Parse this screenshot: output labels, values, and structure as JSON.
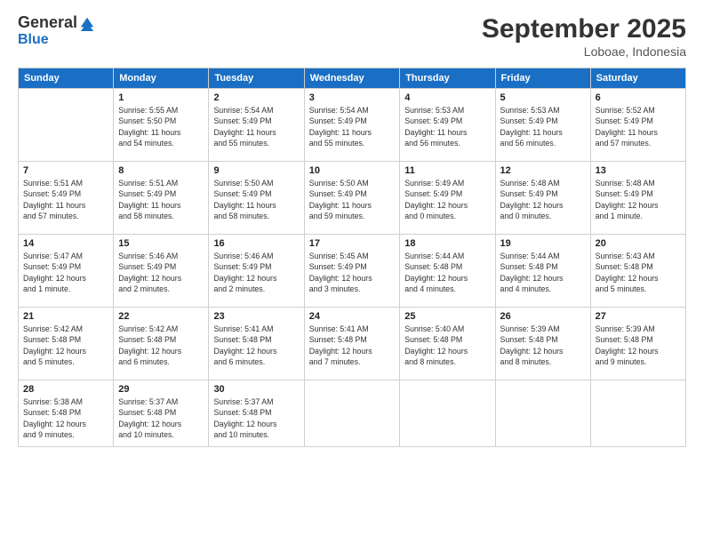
{
  "header": {
    "logo_line1": "General",
    "logo_line2": "Blue",
    "month": "September 2025",
    "location": "Loboae, Indonesia"
  },
  "weekdays": [
    "Sunday",
    "Monday",
    "Tuesday",
    "Wednesday",
    "Thursday",
    "Friday",
    "Saturday"
  ],
  "weeks": [
    [
      {
        "day": "",
        "info": ""
      },
      {
        "day": "1",
        "info": "Sunrise: 5:55 AM\nSunset: 5:50 PM\nDaylight: 11 hours\nand 54 minutes."
      },
      {
        "day": "2",
        "info": "Sunrise: 5:54 AM\nSunset: 5:49 PM\nDaylight: 11 hours\nand 55 minutes."
      },
      {
        "day": "3",
        "info": "Sunrise: 5:54 AM\nSunset: 5:49 PM\nDaylight: 11 hours\nand 55 minutes."
      },
      {
        "day": "4",
        "info": "Sunrise: 5:53 AM\nSunset: 5:49 PM\nDaylight: 11 hours\nand 56 minutes."
      },
      {
        "day": "5",
        "info": "Sunrise: 5:53 AM\nSunset: 5:49 PM\nDaylight: 11 hours\nand 56 minutes."
      },
      {
        "day": "6",
        "info": "Sunrise: 5:52 AM\nSunset: 5:49 PM\nDaylight: 11 hours\nand 57 minutes."
      }
    ],
    [
      {
        "day": "7",
        "info": "Sunrise: 5:51 AM\nSunset: 5:49 PM\nDaylight: 11 hours\nand 57 minutes."
      },
      {
        "day": "8",
        "info": "Sunrise: 5:51 AM\nSunset: 5:49 PM\nDaylight: 11 hours\nand 58 minutes."
      },
      {
        "day": "9",
        "info": "Sunrise: 5:50 AM\nSunset: 5:49 PM\nDaylight: 11 hours\nand 58 minutes."
      },
      {
        "day": "10",
        "info": "Sunrise: 5:50 AM\nSunset: 5:49 PM\nDaylight: 11 hours\nand 59 minutes."
      },
      {
        "day": "11",
        "info": "Sunrise: 5:49 AM\nSunset: 5:49 PM\nDaylight: 12 hours\nand 0 minutes."
      },
      {
        "day": "12",
        "info": "Sunrise: 5:48 AM\nSunset: 5:49 PM\nDaylight: 12 hours\nand 0 minutes."
      },
      {
        "day": "13",
        "info": "Sunrise: 5:48 AM\nSunset: 5:49 PM\nDaylight: 12 hours\nand 1 minute."
      }
    ],
    [
      {
        "day": "14",
        "info": "Sunrise: 5:47 AM\nSunset: 5:49 PM\nDaylight: 12 hours\nand 1 minute."
      },
      {
        "day": "15",
        "info": "Sunrise: 5:46 AM\nSunset: 5:49 PM\nDaylight: 12 hours\nand 2 minutes."
      },
      {
        "day": "16",
        "info": "Sunrise: 5:46 AM\nSunset: 5:49 PM\nDaylight: 12 hours\nand 2 minutes."
      },
      {
        "day": "17",
        "info": "Sunrise: 5:45 AM\nSunset: 5:49 PM\nDaylight: 12 hours\nand 3 minutes."
      },
      {
        "day": "18",
        "info": "Sunrise: 5:44 AM\nSunset: 5:48 PM\nDaylight: 12 hours\nand 4 minutes."
      },
      {
        "day": "19",
        "info": "Sunrise: 5:44 AM\nSunset: 5:48 PM\nDaylight: 12 hours\nand 4 minutes."
      },
      {
        "day": "20",
        "info": "Sunrise: 5:43 AM\nSunset: 5:48 PM\nDaylight: 12 hours\nand 5 minutes."
      }
    ],
    [
      {
        "day": "21",
        "info": "Sunrise: 5:42 AM\nSunset: 5:48 PM\nDaylight: 12 hours\nand 5 minutes."
      },
      {
        "day": "22",
        "info": "Sunrise: 5:42 AM\nSunset: 5:48 PM\nDaylight: 12 hours\nand 6 minutes."
      },
      {
        "day": "23",
        "info": "Sunrise: 5:41 AM\nSunset: 5:48 PM\nDaylight: 12 hours\nand 6 minutes."
      },
      {
        "day": "24",
        "info": "Sunrise: 5:41 AM\nSunset: 5:48 PM\nDaylight: 12 hours\nand 7 minutes."
      },
      {
        "day": "25",
        "info": "Sunrise: 5:40 AM\nSunset: 5:48 PM\nDaylight: 12 hours\nand 8 minutes."
      },
      {
        "day": "26",
        "info": "Sunrise: 5:39 AM\nSunset: 5:48 PM\nDaylight: 12 hours\nand 8 minutes."
      },
      {
        "day": "27",
        "info": "Sunrise: 5:39 AM\nSunset: 5:48 PM\nDaylight: 12 hours\nand 9 minutes."
      }
    ],
    [
      {
        "day": "28",
        "info": "Sunrise: 5:38 AM\nSunset: 5:48 PM\nDaylight: 12 hours\nand 9 minutes."
      },
      {
        "day": "29",
        "info": "Sunrise: 5:37 AM\nSunset: 5:48 PM\nDaylight: 12 hours\nand 10 minutes."
      },
      {
        "day": "30",
        "info": "Sunrise: 5:37 AM\nSunset: 5:48 PM\nDaylight: 12 hours\nand 10 minutes."
      },
      {
        "day": "",
        "info": ""
      },
      {
        "day": "",
        "info": ""
      },
      {
        "day": "",
        "info": ""
      },
      {
        "day": "",
        "info": ""
      }
    ]
  ]
}
